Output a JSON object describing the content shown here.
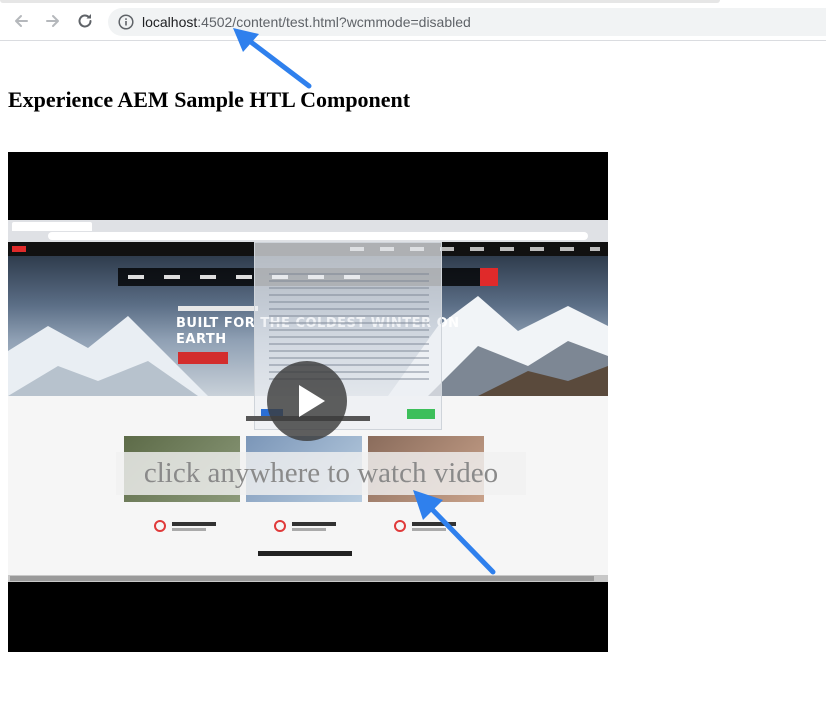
{
  "browser": {
    "url_host": "localhost",
    "url_rest": ":4502/content/test.html?wcmmode=disabled",
    "back_icon": "arrow-left-icon",
    "forward_icon": "arrow-right-icon",
    "reload_icon": "reload-icon",
    "info_icon": "info-icon"
  },
  "page": {
    "title": "Experience AEM Sample HTL Component"
  },
  "video": {
    "cta_text": "click anywhere to watch video",
    "thumbnail": {
      "headline_line1": "BUILT FOR THE COLDEST WINTER ON",
      "headline_line2": "EARTH"
    },
    "play_icon": "play-icon"
  },
  "colors": {
    "annotation_arrow": "#2f80ed",
    "page_background": "#ffffff",
    "video_background": "#000000"
  }
}
